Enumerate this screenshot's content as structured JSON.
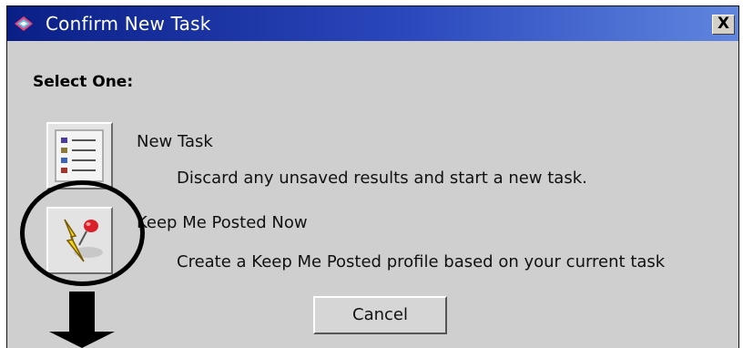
{
  "window": {
    "title": "Confirm New Task",
    "close_label": "X"
  },
  "dialog": {
    "heading": "Select One:",
    "options": [
      {
        "title": "New Task",
        "description": "Discard any unsaved results and start a new task.",
        "icon": "task-list-icon"
      },
      {
        "title": "Keep Me Posted Now",
        "description": "Create a Keep Me Posted profile based on your current task",
        "icon": "lightning-pin-icon"
      }
    ],
    "cancel_label": "Cancel"
  },
  "annotations": {
    "circle_target": "keep-me-posted-button",
    "arrow_direction": "down"
  },
  "colors": {
    "titlebar_start": "#0a1f86",
    "titlebar_end": "#5f86df",
    "dialog_bg": "#cfcfcf"
  }
}
